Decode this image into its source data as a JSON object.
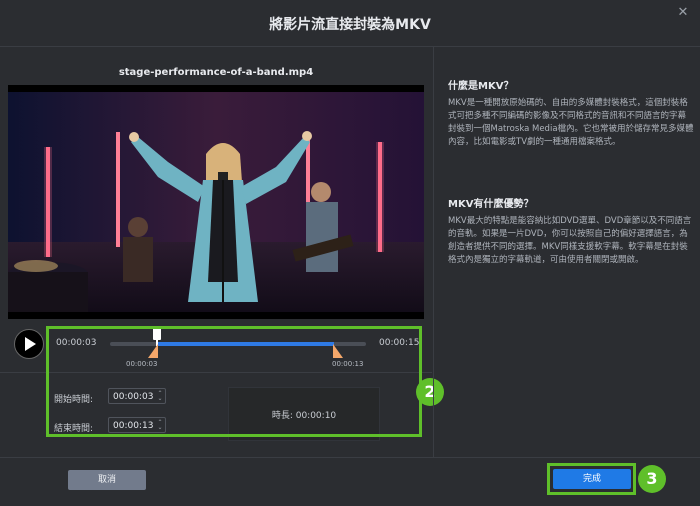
{
  "window": {
    "title": "將影片流直接封裝為MKV",
    "close_icon": "close-icon"
  },
  "player": {
    "filename": "stage-performance-of-a-band.mp4",
    "current_time": "00:00:03",
    "total_time": "00:00:15",
    "range_start_label": "00:00:03",
    "range_end_label": "00:00:13"
  },
  "trim": {
    "start_label": "開始時間:",
    "start_value": "00:00:03",
    "end_label": "結束時間:",
    "end_value": "00:00:13",
    "duration_text": "時長:  00:00:10"
  },
  "info": {
    "q1_title": "什麼是MKV？",
    "q1_body": "MKV是一種開放原始碼的、自由的多媒體封裝格式，這個封裝格式可把多種不同編碼的影像及不同格式的音訊和不同語言的字幕封裝到一個Matroska Media檔內。它也常被用於儲存常見多媒體內容，比如電影或TV劇的一種通用檔案格式。",
    "q2_title": "MKV有什麼優勢？",
    "q2_body": "MKV最大的特點是能容納比如DVD選單、DVD章節以及不同語言的音軌。如果是一片DVD，你可以按照自己的偏好選擇語言，為創造者提供不同的選擇。MKV同樣支援軟字幕。軟字幕是在封裝格式內是獨立的字幕軌道，可由使用者關閉或開啟。"
  },
  "footer": {
    "cancel_label": "取消",
    "done_label": "完成"
  },
  "annotations": {
    "badge_2": "2",
    "badge_3": "3"
  },
  "colors": {
    "accent": "#1f7ae6",
    "annotation_green": "#5fbf2a",
    "handle": "#f4a76a"
  }
}
